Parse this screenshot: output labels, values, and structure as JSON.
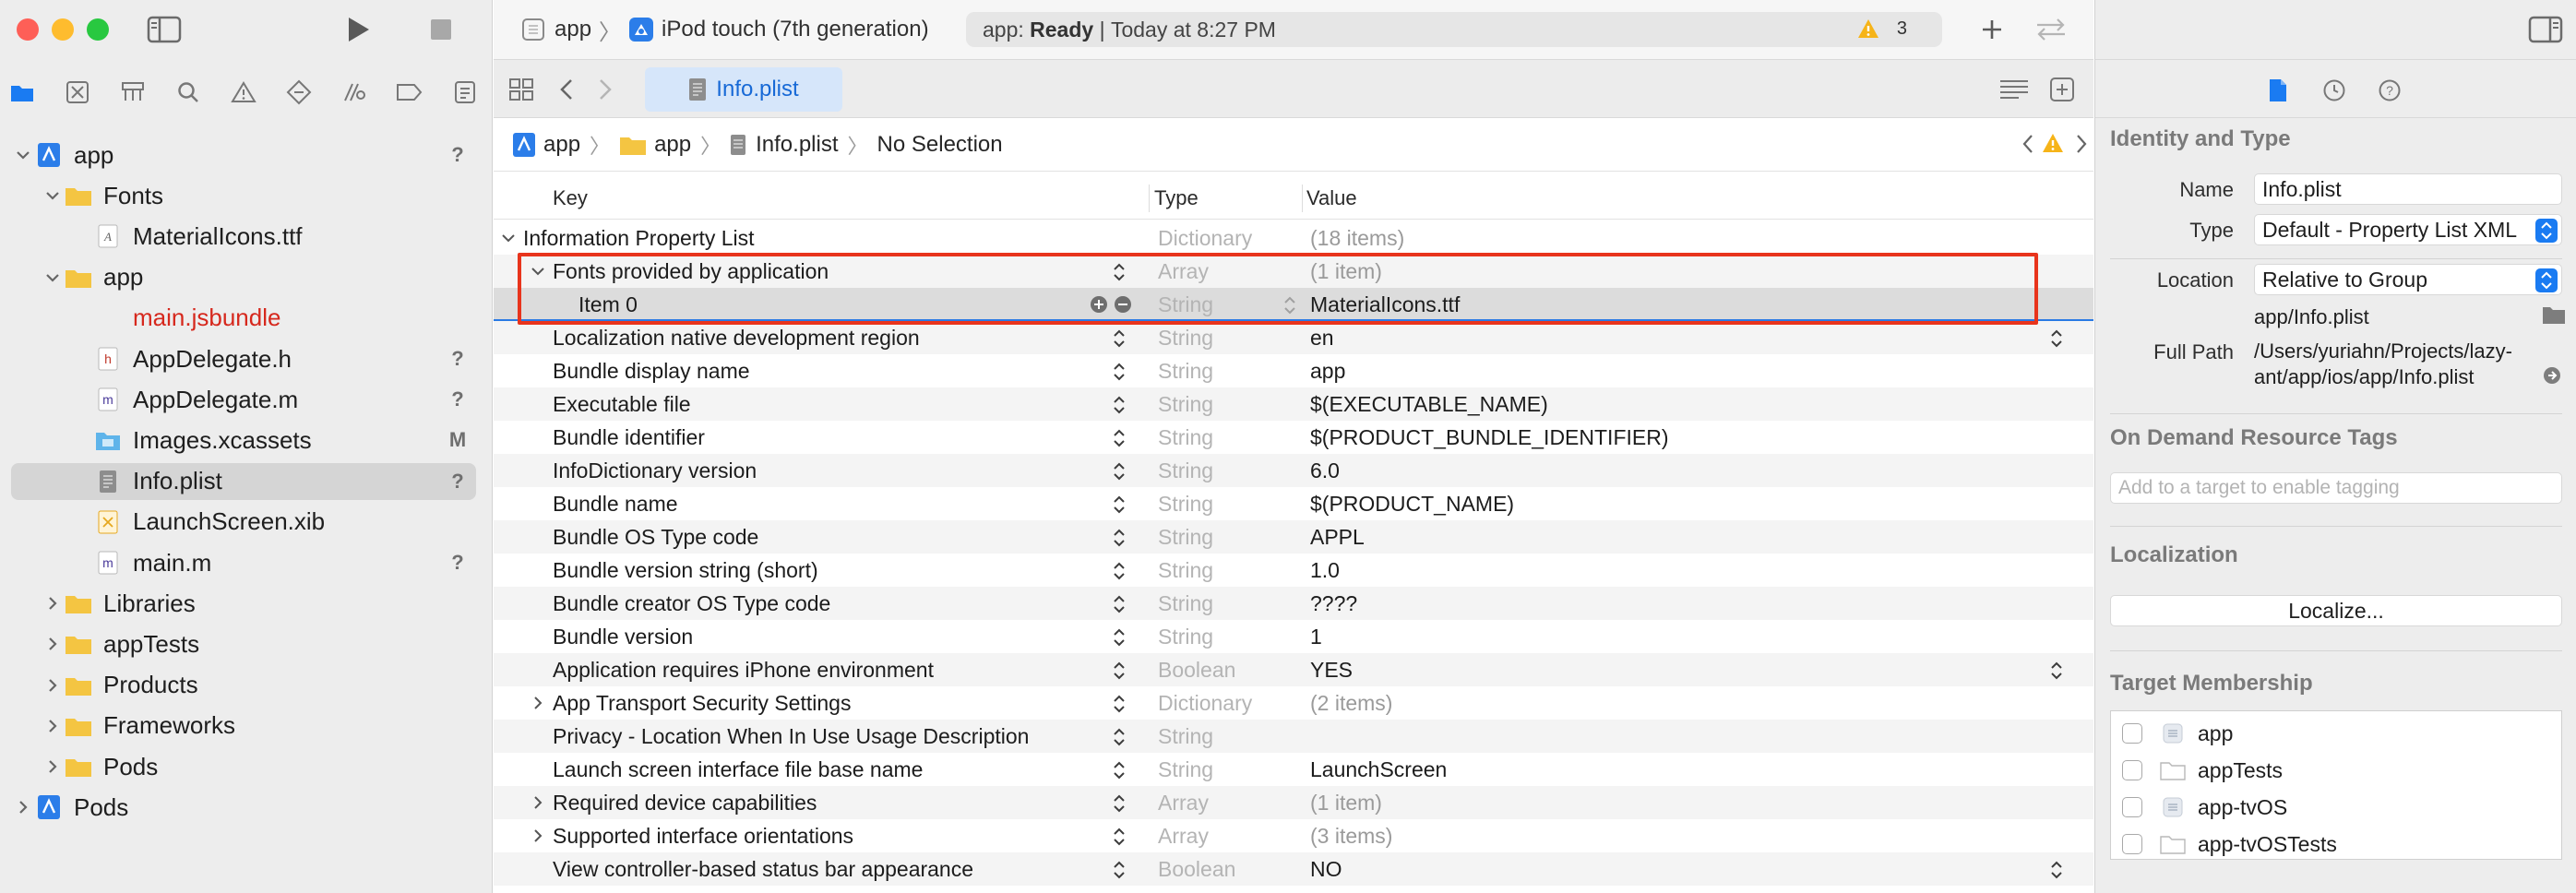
{
  "window": {
    "scheme_target": "app",
    "scheme_device": "iPod touch (7th generation)",
    "status_prefix": "app: ",
    "status_state": "Ready",
    "status_separator": " | ",
    "status_time": "Today at 8:27 PM",
    "warning_count": "3"
  },
  "navigator": {
    "tree": [
      {
        "label": "app",
        "badge": "?",
        "kind": "project",
        "level": 0,
        "expanded": true
      },
      {
        "label": "Fonts",
        "badge": "",
        "kind": "folder",
        "level": 1,
        "expanded": true
      },
      {
        "label": "MaterialIcons.ttf",
        "badge": "",
        "kind": "font",
        "level": 2
      },
      {
        "label": "app",
        "badge": "",
        "kind": "folder",
        "level": 1,
        "expanded": true
      },
      {
        "label": "main.jsbundle",
        "badge": "",
        "kind": "missing",
        "level": 2
      },
      {
        "label": "AppDelegate.h",
        "badge": "?",
        "kind": "h",
        "level": 2
      },
      {
        "label": "AppDelegate.m",
        "badge": "?",
        "kind": "m",
        "level": 2
      },
      {
        "label": "Images.xcassets",
        "badge": "M",
        "kind": "assets",
        "level": 2
      },
      {
        "label": "Info.plist",
        "badge": "?",
        "kind": "plist",
        "level": 2,
        "selected": true
      },
      {
        "label": "LaunchScreen.xib",
        "badge": "",
        "kind": "xib",
        "level": 2
      },
      {
        "label": "main.m",
        "badge": "?",
        "kind": "m",
        "level": 2
      },
      {
        "label": "Libraries",
        "badge": "",
        "kind": "folder",
        "level": 1,
        "expanded": false
      },
      {
        "label": "appTests",
        "badge": "",
        "kind": "folder",
        "level": 1,
        "expanded": false
      },
      {
        "label": "Products",
        "badge": "",
        "kind": "folder",
        "level": 1,
        "expanded": false
      },
      {
        "label": "Frameworks",
        "badge": "",
        "kind": "folder",
        "level": 1,
        "expanded": false
      },
      {
        "label": "Pods",
        "badge": "",
        "kind": "folder",
        "level": 1,
        "expanded": false
      },
      {
        "label": "Pods",
        "badge": "",
        "kind": "project",
        "level": 0,
        "expanded": false
      }
    ]
  },
  "editor": {
    "tab_label": "Info.plist",
    "breadcrumb": [
      "app",
      "app",
      "Info.plist",
      "No Selection"
    ],
    "columns": {
      "key": "Key",
      "type": "Type",
      "value": "Value"
    },
    "rows": [
      {
        "key": "Information Property List",
        "type": "Dictionary",
        "value": "(18 items)",
        "level": 0,
        "expander": "open",
        "dim": true
      },
      {
        "key": "Fonts provided by application",
        "type": "Array",
        "value": "(1 item)",
        "level": 1,
        "expander": "open",
        "dim": true
      },
      {
        "key": "Item 0",
        "type": "String",
        "value": "MaterialIcons.ttf",
        "level": 2,
        "selected": true
      },
      {
        "key": "Localization native development region",
        "type": "String",
        "value": "en",
        "level": 1,
        "popup": true
      },
      {
        "key": "Bundle display name",
        "type": "String",
        "value": "app",
        "level": 1
      },
      {
        "key": "Executable file",
        "type": "String",
        "value": "$(EXECUTABLE_NAME)",
        "level": 1
      },
      {
        "key": "Bundle identifier",
        "type": "String",
        "value": "$(PRODUCT_BUNDLE_IDENTIFIER)",
        "level": 1
      },
      {
        "key": "InfoDictionary version",
        "type": "String",
        "value": "6.0",
        "level": 1
      },
      {
        "key": "Bundle name",
        "type": "String",
        "value": "$(PRODUCT_NAME)",
        "level": 1
      },
      {
        "key": "Bundle OS Type code",
        "type": "String",
        "value": "APPL",
        "level": 1
      },
      {
        "key": "Bundle version string (short)",
        "type": "String",
        "value": "1.0",
        "level": 1
      },
      {
        "key": "Bundle creator OS Type code",
        "type": "String",
        "value": "????",
        "level": 1
      },
      {
        "key": "Bundle version",
        "type": "String",
        "value": "1",
        "level": 1
      },
      {
        "key": "Application requires iPhone environment",
        "type": "Boolean",
        "value": "YES",
        "level": 1,
        "popup": true
      },
      {
        "key": "App Transport Security Settings",
        "type": "Dictionary",
        "value": "(2 items)",
        "level": 1,
        "expander": "closed",
        "dim": true
      },
      {
        "key": "Privacy - Location When In Use Usage Description",
        "type": "String",
        "value": "",
        "level": 1
      },
      {
        "key": "Launch screen interface file base name",
        "type": "String",
        "value": "LaunchScreen",
        "level": 1
      },
      {
        "key": "Required device capabilities",
        "type": "Array",
        "value": "(1 item)",
        "level": 1,
        "expander": "closed",
        "dim": true
      },
      {
        "key": "Supported interface orientations",
        "type": "Array",
        "value": "(3 items)",
        "level": 1,
        "expander": "closed",
        "dim": true
      },
      {
        "key": "View controller-based status bar appearance",
        "type": "Boolean",
        "value": "NO",
        "level": 1,
        "popup": true
      }
    ]
  },
  "inspector": {
    "identity_title": "Identity and Type",
    "name_label": "Name",
    "name_value": "Info.plist",
    "type_label": "Type",
    "type_value": "Default - Property List XML",
    "location_label": "Location",
    "location_value": "Relative to Group",
    "location_path": "app/Info.plist",
    "fullpath_label": "Full Path",
    "fullpath_line1": "/Users/yuriahn/Projects/lazy-",
    "fullpath_line2": "ant/app/ios/app/Info.plist",
    "odr_title": "On Demand Resource Tags",
    "odr_placeholder": "Add to a target to enable tagging",
    "localization_title": "Localization",
    "localize_button": "Localize...",
    "membership_title": "Target Membership",
    "targets": [
      {
        "label": "app",
        "kind": "app"
      },
      {
        "label": "appTests",
        "kind": "test"
      },
      {
        "label": "app-tvOS",
        "kind": "app"
      },
      {
        "label": "app-tvOSTests",
        "kind": "test"
      }
    ]
  }
}
